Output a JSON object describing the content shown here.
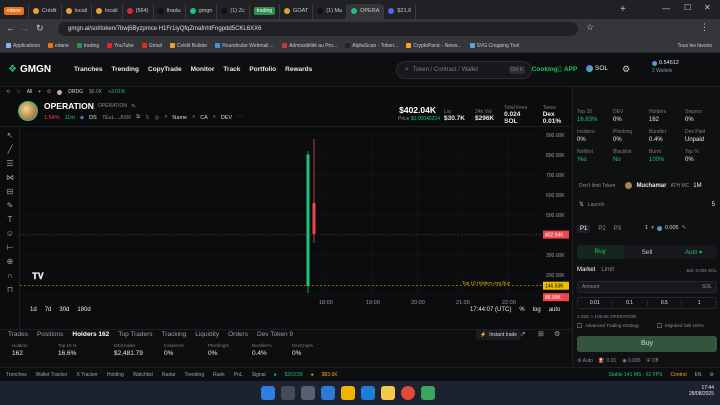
{
  "tabs": [
    {
      "label": "edane",
      "kind": "pill",
      "color": "#e8711a"
    },
    {
      "label": "Crédit",
      "color": "#e8a23a"
    },
    {
      "label": "locali",
      "color": "#e8a23a"
    },
    {
      "label": "locali",
      "color": "#e8a23a"
    },
    {
      "label": "(564)",
      "color": "#e02a2a"
    },
    {
      "label": "Itradu",
      "color": "#101010"
    },
    {
      "label": "gmgn",
      "color": "#1ec27a"
    },
    {
      "label": "(1) Zc",
      "color": "#101010"
    },
    {
      "label": "trading",
      "kind": "pill",
      "color": "#2f8f4f"
    },
    {
      "label": "GOAT",
      "color": "#d9a43a"
    },
    {
      "label": "(1) Ma",
      "color": "#101010"
    },
    {
      "label": "OPERA",
      "color": "#1ec27a",
      "active": true
    },
    {
      "label": "$21,6",
      "color": "#5865f2"
    }
  ],
  "address": {
    "url": "gmgn.ai/sol/token/7bwj5Byzpmce H1Fr1iyQfqZmafnhtFngpdd5CKL6XX6"
  },
  "bookmarks": [
    "Applications",
    "edane",
    "trading",
    "YouTube",
    "Gmail",
    "Crédit Builder",
    "Roundcube Webmail ...",
    "Admissibilité au Pro...",
    "AlphaScan - Token...",
    "CryptoPanic - News...",
    "SVG Cropping Tool"
  ],
  "bookmarks_right": "Tous les favoris",
  "nav": {
    "logo": "GMGN",
    "links": [
      "Tranches",
      "Trending",
      "CopyTrade",
      "Monitor",
      "Track",
      "Portfolio",
      "Rewards"
    ],
    "search_placeholder": "Token / Contract / Wallet",
    "search_hint": "Ctrl K",
    "cooking": "Cooking",
    "app": "APP",
    "chain": "SOL",
    "balance": "0.54612",
    "wallet": "2 Wallets"
  },
  "ticker": {
    "all": "All",
    "item": "DRDG",
    "mc": "$6.0K",
    "change": "+3.01%"
  },
  "token": {
    "name": "OPERATION",
    "ticker": "OPERATION",
    "change": "1.54%",
    "age": "11m",
    "ds": "DS",
    "contract": "7EuL...JIXR",
    "links": [
      "Name",
      "CA",
      "DEV"
    ],
    "price_usd": "$402.04K",
    "price_label": "Price",
    "price_sol": "$0.00040204",
    "stats": [
      {
        "label": "Liq",
        "value": "$30.7K"
      },
      {
        "label": "24h Vol",
        "value": "$296K"
      },
      {
        "label": "Total Fees",
        "value": "0.024 SOL"
      },
      {
        "label": "Taxes",
        "value": "Dex 0.01%"
      }
    ]
  },
  "chart_data": {
    "type": "candlestick",
    "y_ticks": [
      "900.00K",
      "800.00K",
      "700.00K",
      "600.00K",
      "500.00K",
      "400.00K",
      "300.00K",
      "200.00K",
      "100.00K"
    ],
    "x_ticks": [
      "18:00",
      "19:00",
      "20:00",
      "21:00",
      "22:00"
    ],
    "price_tags": [
      {
        "label": "402.04K",
        "color": "#f0454b",
        "value": 402040
      },
      {
        "label": "88.99K",
        "color": "#f0454b",
        "value": 88990
      },
      {
        "label": "146.53K",
        "color": "#f0c000",
        "value": 146530
      }
    ],
    "avg_buy_label": "Top 10 Holders Avg Buy",
    "candles": [
      {
        "o": 145000,
        "h": 820000,
        "l": 110000,
        "c": 802000,
        "dir": "up"
      },
      {
        "o": 560000,
        "h": 880000,
        "l": 360000,
        "c": 405000,
        "dir": "down"
      }
    ],
    "time": "17:44:07 (UTC)",
    "pct": "%",
    "log": "log",
    "auto": "auto",
    "ranges": [
      "1d",
      "7d",
      "30d",
      "180d"
    ]
  },
  "bottom": {
    "tabs": [
      "Trades",
      "Positions",
      "Holders 162",
      "Top Traders",
      "Tracking",
      "Liquidity",
      "Orders",
      "Dev Token 9"
    ],
    "instant": "Instant trade",
    "cells": [
      {
        "label": "Holders",
        "value": "162"
      },
      {
        "label": "Top 10 %",
        "value": "16.6%"
      },
      {
        "label": "MC/Holder",
        "value": "$2,481.79"
      },
      {
        "label": "Insiders%",
        "value": "0%"
      },
      {
        "label": "Phishing%",
        "value": "0%"
      },
      {
        "label": "Bundler%",
        "value": "0.4%"
      },
      {
        "label": "DexChip%",
        "value": "0%"
      }
    ]
  },
  "right": {
    "stats": [
      {
        "label": "Top 10",
        "value": "16.63%",
        "color": "#1ec27a"
      },
      {
        "label": "DEV",
        "value": "0%",
        "color": "#e9eaec"
      },
      {
        "label": "Holders",
        "value": "162",
        "color": "#e9eaec"
      },
      {
        "label": "Snipers",
        "value": "0%",
        "color": "#e9eaec"
      },
      {
        "label": "Insiders",
        "value": "0%",
        "color": "#e9eaec"
      },
      {
        "label": "Phishing",
        "value": "0%",
        "color": "#e9eaec"
      },
      {
        "label": "Bundler",
        "value": "0.4%",
        "color": "#e9eaec"
      },
      {
        "label": "Dex Paid",
        "value": "Unpaid",
        "color": "#e9eaec"
      },
      {
        "label": "NoMint",
        "value": "Yes",
        "color": "#1ec27a"
      },
      {
        "label": "Blacklist",
        "value": "No",
        "color": "#1ec27a"
      },
      {
        "label": "Burnt",
        "value": "100%",
        "color": "#1ec27a"
      },
      {
        "label": "Top %",
        "value": "0%",
        "color": "#e9eaec"
      }
    ],
    "dont_limit": "Don't limit Token",
    "muchamar": "Muchamar",
    "muchamar_mc": "ATH MC",
    "muchamar_val": "1M",
    "launch": "Launch",
    "launch_val": "5",
    "presets": [
      "P1",
      "P2",
      "P3"
    ],
    "slot": "1",
    "sol_amt": "0.005",
    "buy": "Buy",
    "sell": "Sell",
    "auto": "Auto",
    "order_tabs": [
      "Market",
      "Limit"
    ],
    "bal": "Bal: 0.005 SOL",
    "amount_label": "Amount",
    "amount_unit": "SOL",
    "quick": [
      "0.01",
      "0.1",
      "0.5",
      "1"
    ],
    "conv": "1 SOL ≈ 106.5K OPERATION",
    "adv": "Advanced Trading Strategy",
    "mig": "Migrated Sell 100%",
    "buy_btn": "Buy",
    "bottom_row": [
      "Auto",
      "0.01",
      "0.005",
      "Off"
    ]
  },
  "footer": {
    "items": [
      "Trenches",
      "Wallet Tracker",
      "X Tracker",
      "Holding",
      "Watchlist",
      "Radar",
      "Trending",
      "Rank",
      "PnL",
      "Signal"
    ],
    "price1": "$203.59",
    "price2": "$83.6K",
    "stable": "Stable 141 MS · 61 FPS",
    "control": "Control",
    "lang": "EN"
  },
  "taskbar": {
    "time": "17:44",
    "date": "28/08/2025"
  }
}
